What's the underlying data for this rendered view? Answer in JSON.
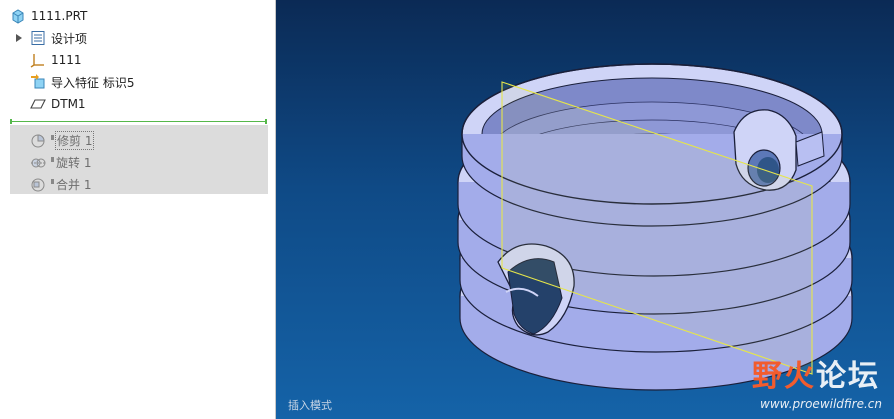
{
  "model_tree": {
    "root": {
      "label": "1111.PRT",
      "icon": "part-icon"
    },
    "items": [
      {
        "label": "设计项",
        "icon": "design-items-icon",
        "expandable": true
      },
      {
        "label": "1111",
        "icon": "coordinate-system-icon"
      },
      {
        "label": "导入特征 标识5",
        "icon": "import-feature-icon"
      },
      {
        "label": "DTM1",
        "icon": "datum-plane-icon"
      }
    ],
    "suppressed_items": [
      {
        "label": "修剪 1",
        "icon": "trim-icon"
      },
      {
        "label": "旋转 1",
        "icon": "revolve-icon"
      },
      {
        "label": "合并 1",
        "icon": "merge-icon"
      }
    ]
  },
  "viewport": {
    "status_text": "插入模式",
    "watermark": {
      "title_a": "野火",
      "title_b": "论坛",
      "url": "www.proewildfire.cn"
    },
    "colors": {
      "model": "#a9b2ee",
      "datum_plane": "#e6e64a",
      "background_top": "#0b2a55",
      "background_bottom": "#1563a8"
    }
  }
}
